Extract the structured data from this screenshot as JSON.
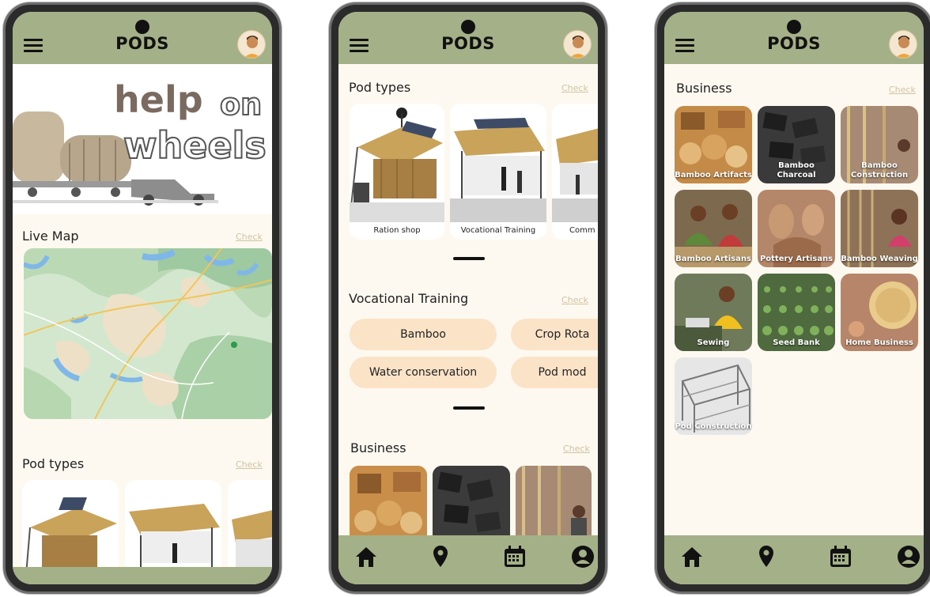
{
  "app": {
    "logo": "PODS"
  },
  "icons": [
    "menu-icon",
    "avatar",
    "home-icon",
    "location-pin-icon",
    "calendar-icon",
    "account-icon"
  ],
  "colors": {
    "header": "#a4b088",
    "background": "#fdf8f0",
    "pill": "#fbe3c8",
    "check": "#cfc3a2"
  },
  "screen1": {
    "hero": {
      "word1": "help",
      "word2": "on",
      "word3": "wheels"
    },
    "live_map": {
      "title": "Live Map",
      "check": "Check"
    },
    "pod_types": {
      "title": "Pod types",
      "check": "Check"
    }
  },
  "screen2": {
    "pod_types": {
      "title": "Pod types",
      "check": "Check",
      "cards": [
        {
          "label": "Ration shop"
        },
        {
          "label": "Vocational Training"
        },
        {
          "label": "Comm"
        }
      ]
    },
    "vocational": {
      "title": "Vocational Training",
      "check": "Check",
      "pills": [
        {
          "label": "Bamboo"
        },
        {
          "label": "Crop Rota"
        },
        {
          "label": "Water conservation"
        },
        {
          "label": "Pod mod"
        }
      ]
    },
    "business": {
      "title": "Business",
      "check": "Check"
    }
  },
  "screen3": {
    "business": {
      "title": "Business",
      "check": "Check",
      "tiles": [
        {
          "label": "Bamboo Artifacts"
        },
        {
          "label": "Bamboo Charcoal"
        },
        {
          "label": "Bamboo Construction"
        },
        {
          "label": "Bamboo Artisans"
        },
        {
          "label": "Pottery Artisans"
        },
        {
          "label": "Bamboo Weaving"
        },
        {
          "label": "Sewing"
        },
        {
          "label": "Seed Bank"
        },
        {
          "label": "Home Business"
        },
        {
          "label": "Pod Construction"
        }
      ]
    }
  }
}
